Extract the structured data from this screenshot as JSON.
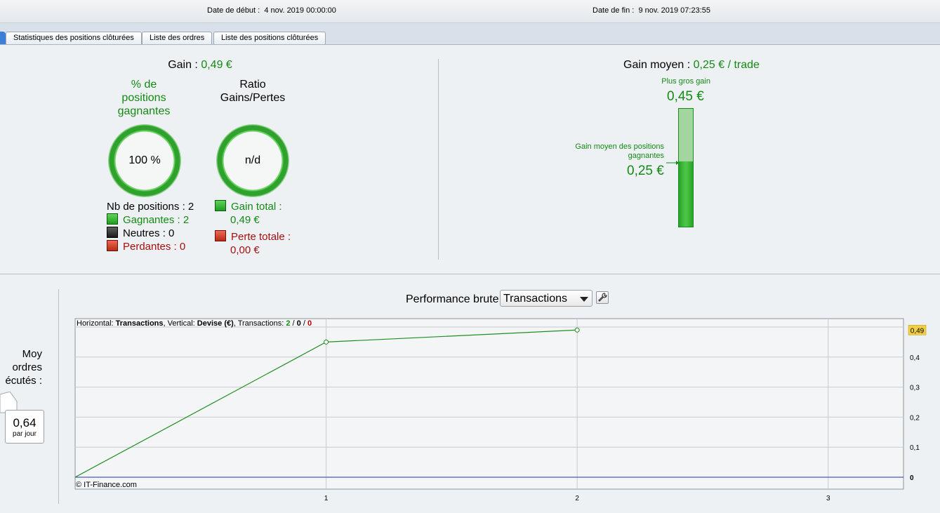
{
  "header": {
    "start_label": "Date de début :",
    "start_value": "4 nov. 2019 00:00:00",
    "end_label": "Date de fin :",
    "end_value": "9 nov. 2019 07:23:55"
  },
  "tabs": [
    {
      "label": "Statistiques des positions clôturées"
    },
    {
      "label": "Liste des ordres"
    },
    {
      "label": "Liste des positions clôturées"
    }
  ],
  "summary": {
    "gain_label": "Gain :",
    "gain_value": "0,49 €",
    "win_pct_title": [
      "% de",
      "positions",
      "gagnantes"
    ],
    "win_pct_value": "100 %",
    "ratio_title": [
      "Ratio",
      "Gains/Pertes"
    ],
    "ratio_value": "n/d",
    "nb_positions": "Nb de positions : 2",
    "winners": "Gagnantes : 2",
    "neutral": "Neutres : 0",
    "losers": "Perdantes : 0",
    "total_gain_label": "Gain total :",
    "total_gain_value": "0,49 €",
    "total_loss_label": "Perte totale :",
    "total_loss_value": "0,00 €",
    "colors": {
      "green": "#138a13",
      "red": "#a50f0f"
    }
  },
  "average": {
    "title_label": "Gain moyen :",
    "title_value": "0,25 € / trade",
    "biggest_label": "Plus gros gain",
    "biggest_value": "0,45 €",
    "avg_win_label": [
      "Gain moyen des positions",
      "gagnantes"
    ],
    "avg_win_value": "0,25 €",
    "avg_fraction": 0.556
  },
  "left": {
    "label": [
      "Moy",
      "ordres",
      "écutés :"
    ],
    "per_day_value": "0,64",
    "per_day_unit": "par jour"
  },
  "performance": {
    "title": "Performance brute",
    "select_value": "Transactions",
    "info": {
      "h_label": "Horizontal: ",
      "h_value": "Transactions",
      "v_label": ", Vertical: ",
      "v_value": "Devise (€)",
      "t_label": ", Transactions: ",
      "t_win": "2",
      "sep": " / ",
      "t_neutral": "0",
      "t_loss": "0"
    },
    "copyright": "© IT-Finance.com"
  },
  "chart_data": {
    "type": "line",
    "title": "",
    "xlabel": "",
    "ylabel": "",
    "x": [
      0,
      1,
      2
    ],
    "series": [
      {
        "values": [
          0,
          0.45,
          0.49
        ]
      }
    ],
    "x_ticks": [
      "1",
      "2",
      "3"
    ],
    "x_tick_values": [
      1,
      2,
      3
    ],
    "y_ticks": [
      "0",
      "0,1",
      "0,2",
      "0,3",
      "0,4"
    ],
    "y_tick_values": [
      0,
      0.1,
      0.2,
      0.3,
      0.4
    ],
    "xlim": [
      0,
      3.3
    ],
    "ylim": [
      0,
      0.5
    ],
    "last_value_badge": "0,49",
    "grid": true,
    "line_color": "#1f8f1f",
    "baseline_color": "#2233aa",
    "badge_color": "#f0d040"
  }
}
